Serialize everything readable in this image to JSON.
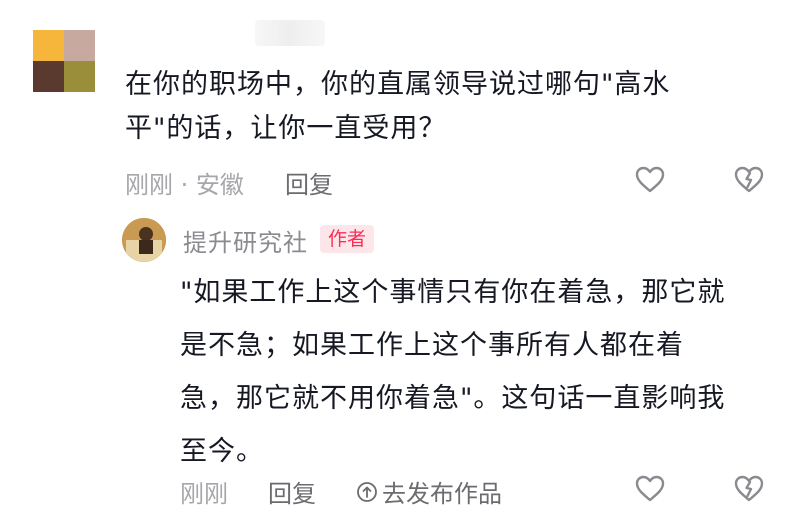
{
  "comment": {
    "avatar_colors": [
      "#f5b63b",
      "#c8a9a0",
      "#5a3a2e",
      "#9b8e3a"
    ],
    "text": "在你的职场中，你的直属领导说过哪句\"高水\n平\"的话，让你一直受用？",
    "meta": "刚刚 · 安徽",
    "reply_label": "回复",
    "like_icon": "heart-outline-icon",
    "dislike_icon": "broken-heart-icon"
  },
  "reply": {
    "author_name": "提升研究社",
    "author_badge": "作者",
    "text": "\"如果工作上这个事情只有你在着急，那它就\n是不急；如果工作上这个事所有人都在着\n急，那它就不用你着急\"。这句话一直影响我\n至今。",
    "meta": "刚刚",
    "reply_label": "回复",
    "publish_label": "去发布作品",
    "badge_color": "#fe2c55"
  }
}
